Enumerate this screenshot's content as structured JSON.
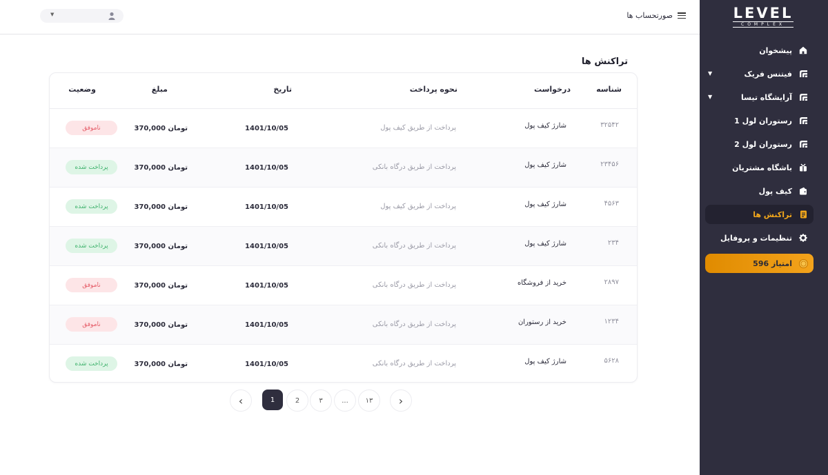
{
  "brand": {
    "name": "LEVEL",
    "sub": "COMPLEX"
  },
  "sidebar": {
    "items": [
      {
        "label": "پیشخوان",
        "icon": "home-icon"
      },
      {
        "label": "فیتنس فریک",
        "icon": "brand-icon",
        "has_dropdown": true
      },
      {
        "label": "آرایشگاه تیسا",
        "icon": "brand-icon",
        "has_dropdown": true
      },
      {
        "label": "رستوران لول 1",
        "icon": "brand-icon"
      },
      {
        "label": "رستوران لول 2",
        "icon": "brand-icon"
      },
      {
        "label": "باشگاه مشتریان",
        "icon": "gift-icon"
      },
      {
        "label": "کیف پول",
        "icon": "wallet-icon"
      },
      {
        "label": "تراکنش ها",
        "icon": "receipt-icon",
        "active": true
      },
      {
        "label": "تنظیمات و پروفایل",
        "icon": "gear-icon"
      }
    ],
    "points": {
      "label": "596 امتیاز",
      "icon": "coin-icon"
    }
  },
  "topbar": {
    "menu_label": "صورتحساب ها"
  },
  "page": {
    "title": "تراکنش ها"
  },
  "table": {
    "headers": {
      "id": "شناسه",
      "request": "درخواست",
      "payment": "نحوه پرداخت",
      "date": "تاریخ",
      "amount": "مبلغ",
      "status": "وضعیت"
    },
    "rows": [
      {
        "id": "۳۲۵۴۲",
        "request": "شارژ کیف پول",
        "payment": "پرداخت از طریق کیف پول",
        "date": "1401/10/05",
        "amount": "370,000 تومان",
        "status": "ناموفق",
        "status_type": "fail"
      },
      {
        "id": "۲۳۴۵۶",
        "request": "شارژ کیف پول",
        "payment": "پرداخت از طریق درگاه بانکی",
        "date": "1401/10/05",
        "amount": "370,000 تومان",
        "status": "پرداخت شده",
        "status_type": "ok"
      },
      {
        "id": "۴۵۶۳",
        "request": "شارژ کیف پول",
        "payment": "پرداخت از طریق کیف پول",
        "date": "1401/10/05",
        "amount": "370,000 تومان",
        "status": "پرداخت شده",
        "status_type": "ok"
      },
      {
        "id": "۲۳۴",
        "request": "شارژ کیف پول",
        "payment": "پرداخت از طریق درگاه بانکی",
        "date": "1401/10/05",
        "amount": "370,000 تومان",
        "status": "پرداخت شده",
        "status_type": "ok"
      },
      {
        "id": "۲۸۹۷",
        "request": "خرید از فروشگاه",
        "payment": "پرداخت از طریق درگاه بانکی",
        "date": "1401/10/05",
        "amount": "370,000 تومان",
        "status": "ناموفق",
        "status_type": "fail"
      },
      {
        "id": "۱۲۳۴",
        "request": "خرید از رستوران",
        "payment": "پرداخت از طریق درگاه بانکی",
        "date": "1401/10/05",
        "amount": "370,000 تومان",
        "status": "ناموفق",
        "status_type": "fail"
      },
      {
        "id": "۵۶۲۸",
        "request": "شارژ کیف پول",
        "payment": "پرداخت از طریق درگاه بانکی",
        "date": "1401/10/05",
        "amount": "370,000 تومان",
        "status": "پرداخت شده",
        "status_type": "ok"
      }
    ]
  },
  "pagination": {
    "prev": "‹",
    "next": "›",
    "pages": [
      "1",
      "2",
      "۳",
      "...",
      "۱۳"
    ],
    "current": "1"
  },
  "colors": {
    "sidebar_bg": "#2f2e3e",
    "accent": "#f2a71b",
    "fail": "#e55a66",
    "ok": "#3cb16a"
  }
}
